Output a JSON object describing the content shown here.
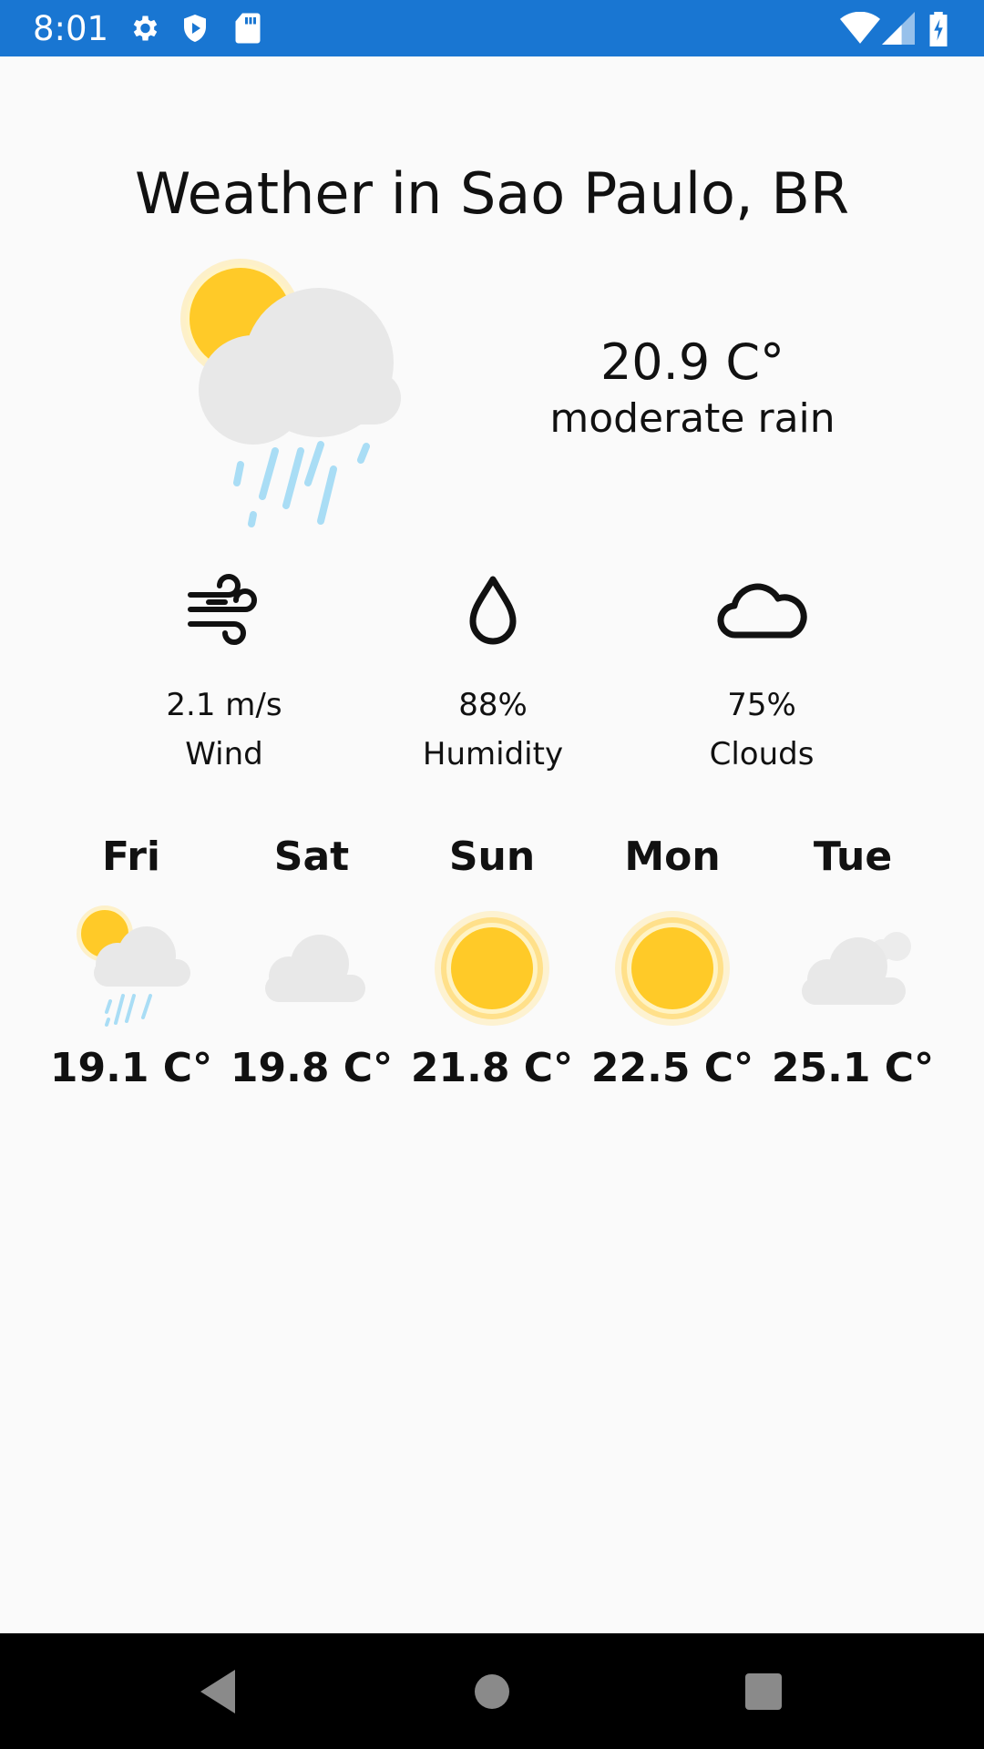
{
  "status_bar": {
    "time": "8:01",
    "left_icons": [
      "gear-icon",
      "shield-icon",
      "sd-card-icon"
    ],
    "right_icons": [
      "wifi-icon",
      "signal-icon",
      "battery-charging-icon"
    ],
    "color": "#1976d2"
  },
  "weather": {
    "title": "Weather in Sao Paulo, BR",
    "icon": "sun-cloud-rain-icon",
    "temperature": "20.9 C°",
    "description": "moderate rain"
  },
  "stats": [
    {
      "icon": "wind-icon",
      "value": "2.1 m/s",
      "label": "Wind"
    },
    {
      "icon": "droplet-icon",
      "value": "88%",
      "label": "Humidity"
    },
    {
      "icon": "cloud-icon",
      "value": "75%",
      "label": "Clouds"
    }
  ],
  "forecast": [
    {
      "day": "Fri",
      "icon": "sun-cloud-rain-icon",
      "temp": "19.1 C°"
    },
    {
      "day": "Sat",
      "icon": "cloud-icon",
      "temp": "19.8 C°"
    },
    {
      "day": "Sun",
      "icon": "sun-icon",
      "temp": "21.8 C°"
    },
    {
      "day": "Mon",
      "icon": "sun-icon",
      "temp": "22.5 C°"
    },
    {
      "day": "Tue",
      "icon": "cloud-icon",
      "temp": "25.1 C°"
    }
  ],
  "nav_bar": {
    "buttons": [
      "back-icon",
      "home-icon",
      "recents-icon"
    ]
  }
}
